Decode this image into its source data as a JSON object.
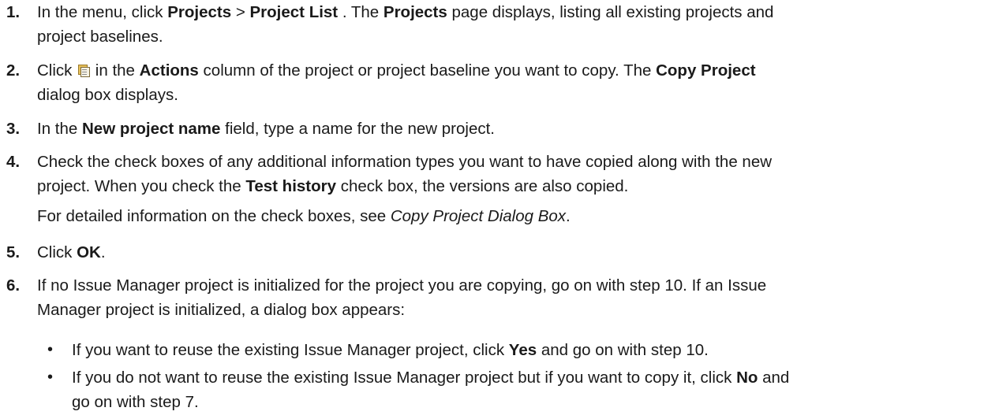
{
  "steps": [
    {
      "num": "1.",
      "lines": [
        [
          "In the menu, click ",
          {
            "b": "Projects"
          },
          " > ",
          {
            "b": "Project List"
          },
          " . The ",
          {
            "b": "Projects"
          },
          " page displays, listing all existing projects and"
        ],
        [
          "project baselines."
        ]
      ]
    },
    {
      "num": "2.",
      "lines": [
        [
          "Click ",
          {
            "icon": "copy-icon"
          },
          " in the ",
          {
            "b": "Actions"
          },
          " column of the project or project baseline you want to copy. The ",
          {
            "b": "Copy Project"
          }
        ],
        [
          "dialog box displays."
        ]
      ]
    },
    {
      "num": "3.",
      "lines": [
        [
          "In the ",
          {
            "b": "New project name"
          },
          " field, type a name for the new project."
        ]
      ]
    },
    {
      "num": "4.",
      "lines": [
        [
          "Check the check boxes of any additional information types you want to have copied along with the new"
        ],
        [
          "project. When you check the ",
          {
            "b": "Test history"
          },
          " check box, the versions are also copied."
        ]
      ],
      "note": [
        "For detailed information on the check boxes, see ",
        {
          "i": "Copy Project Dialog Box"
        },
        "."
      ]
    },
    {
      "num": "5.",
      "lines": [
        [
          "Click ",
          {
            "b": "OK"
          },
          "."
        ]
      ]
    },
    {
      "num": "6.",
      "lines": [
        [
          "If no Issue Manager project is initialized for the project you are copying, go on with step 10. If an Issue"
        ],
        [
          "Manager project is initialized, a dialog box appears:"
        ]
      ],
      "bullets": [
        {
          "symbol": "•",
          "lines": [
            [
              "If you want to reuse the existing Issue Manager project, click ",
              {
                "b": "Yes"
              },
              " and go on with step 10."
            ]
          ]
        },
        {
          "symbol": "•",
          "lines": [
            [
              "If you do not want to reuse the existing Issue Manager project but if you want to copy it, click ",
              {
                "b": "No"
              },
              " and"
            ],
            [
              "go on with step 7."
            ]
          ]
        }
      ]
    }
  ]
}
